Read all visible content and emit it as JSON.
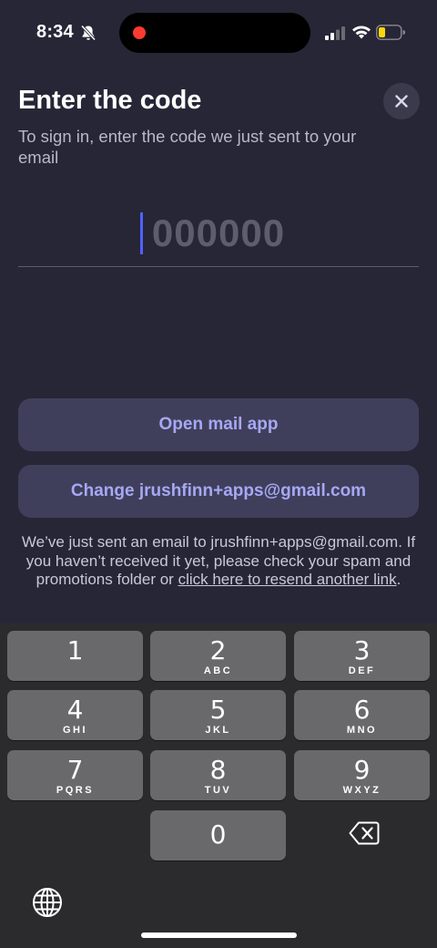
{
  "status": {
    "time": "8:34"
  },
  "screen": {
    "title": "Enter the code",
    "subtitle": "To sign in, enter the code we just sent to your email",
    "code_placeholder": "000000",
    "code_value": ""
  },
  "buttons": {
    "open_mail": "Open mail app",
    "change_email": "Change jrushfinn+apps@gmail.com"
  },
  "note": {
    "text_before": "We’ve just sent an email to jrushfinn+apps@gmail.com. If you haven’t received it yet, please check your spam and promotions folder or ",
    "link": "click here to resend another link",
    "text_after": "."
  },
  "keyboard": {
    "keys": [
      {
        "num": "1",
        "letters": ""
      },
      {
        "num": "2",
        "letters": "ABC"
      },
      {
        "num": "3",
        "letters": "DEF"
      },
      {
        "num": "4",
        "letters": "GHI"
      },
      {
        "num": "5",
        "letters": "JKL"
      },
      {
        "num": "6",
        "letters": "MNO"
      },
      {
        "num": "7",
        "letters": "PQRS"
      },
      {
        "num": "8",
        "letters": "TUV"
      },
      {
        "num": "9",
        "letters": "WXYZ"
      },
      {
        "num": "0",
        "letters": ""
      }
    ]
  },
  "icons": {
    "close": "close-icon",
    "delete": "backspace-icon",
    "globe": "globe-icon",
    "bell": "bell-slash-icon",
    "signal": "cellular-signal-icon",
    "wifi": "wifi-icon",
    "battery": "battery-low-icon"
  },
  "colors": {
    "background": "#272636",
    "button_bg": "#403f5b",
    "button_text": "#a6a8f5",
    "caret": "#4f63ff",
    "battery_fill": "#ffd60a",
    "recording": "#ff3b30"
  }
}
